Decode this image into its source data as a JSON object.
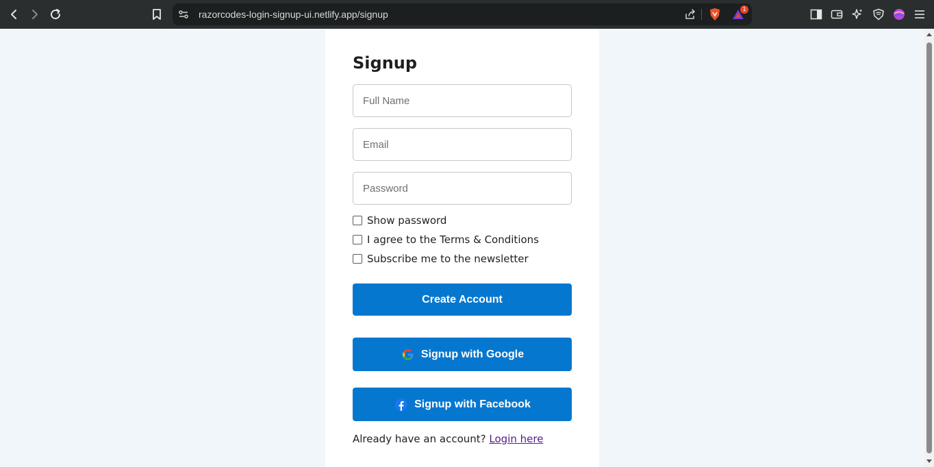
{
  "browser": {
    "url": "razorcodes-login-signup-ui.netlify.app/signup",
    "notification_count": "1",
    "icons": [
      "back-icon",
      "forward-icon",
      "reload-icon",
      "bookmark-icon",
      "site-info-icon",
      "share-icon",
      "brave-shield-icon",
      "brave-rewards-icon",
      "sidebar-icon",
      "wallet-icon",
      "leo-ai-icon",
      "vpn-icon",
      "profile-icon",
      "menu-icon"
    ]
  },
  "form": {
    "title": "Signup",
    "full_name_placeholder": "Full Name",
    "email_placeholder": "Email",
    "password_placeholder": "Password",
    "checkboxes": [
      {
        "label": "Show password",
        "checked": false
      },
      {
        "label": "I agree to the Terms & Conditions",
        "checked": false
      },
      {
        "label": "Subscribe me to the newsletter",
        "checked": false
      }
    ],
    "create_button": "Create Account",
    "google_button": "Signup with Google",
    "facebook_button": "Signup with Facebook",
    "footer_text": "Already have an account?",
    "login_link": "Login here"
  },
  "colors": {
    "primary": "#0677cf",
    "background": "#f1f6fa",
    "card": "#ffffff",
    "toolbar": "#2b2e2f"
  }
}
